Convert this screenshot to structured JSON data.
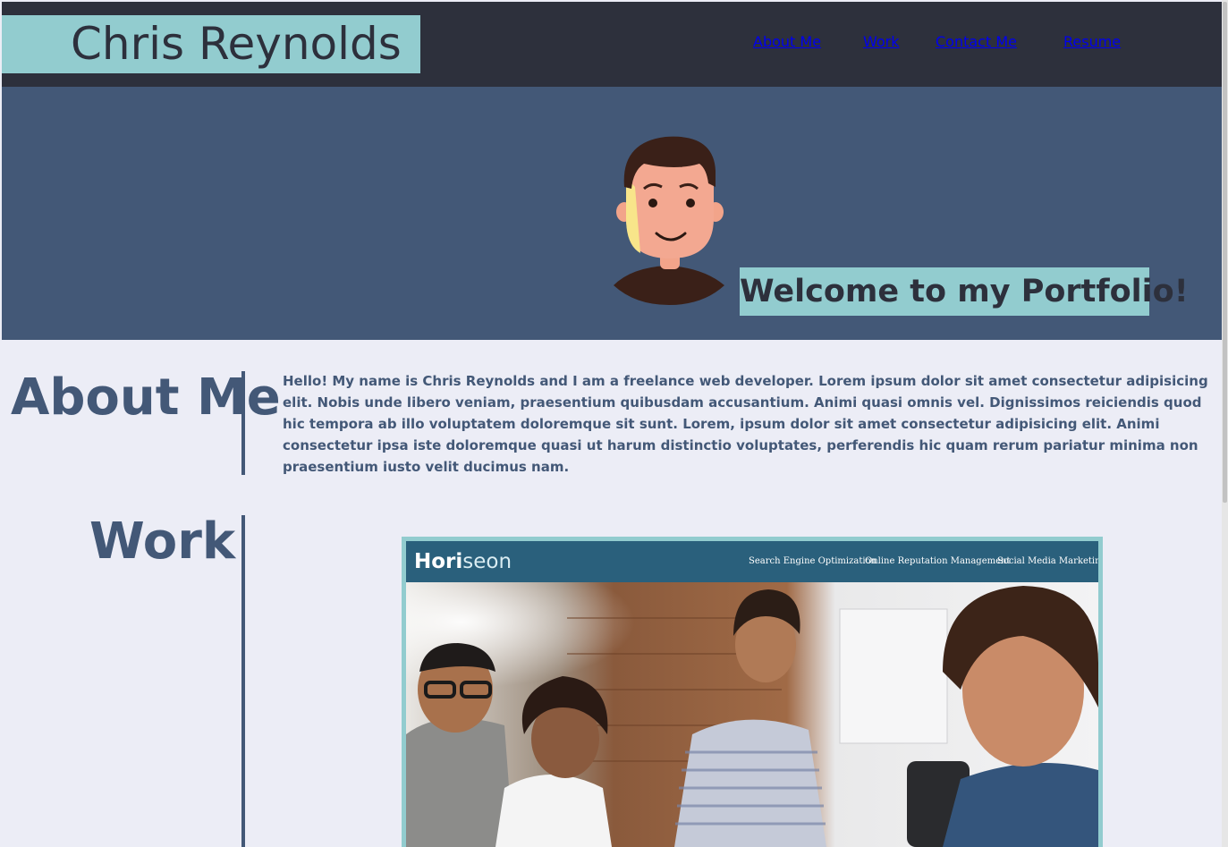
{
  "header": {
    "brand": "Chris Reynolds",
    "nav": [
      {
        "label": "About Me"
      },
      {
        "label": "Work"
      },
      {
        "label": "Contact Me"
      },
      {
        "label": "Resume"
      }
    ]
  },
  "hero": {
    "welcome": "Welcome to my Portfolio!",
    "avatar_icon": "cartoon-man-avatar"
  },
  "about": {
    "title": "About Me",
    "text": "Hello! My name is Chris Reynolds and I am a freelance web developer. Lorem ipsum dolor sit amet consectetur adipisicing elit. Nobis unde libero veniam, praesentium quibusdam accusantium. Animi quasi omnis vel. Dignissimos reiciendis quod hic tempora ab illo voluptatem doloremque sit sunt. Lorem, ipsum dolor sit amet consectetur adipisicing elit. Animi consectetur ipsa iste doloremque quasi ut harum distinctio voluptates, perferendis hic quam rerum pariatur minima non praesentium iusto velit ducimus nam."
  },
  "work": {
    "title": "Work",
    "project": {
      "logo_main": "Hori",
      "logo_accent": "seon",
      "nav": [
        "Search Engine Optimization",
        "Online Reputation Management",
        "Social Media Marketing"
      ]
    }
  },
  "colors": {
    "header_bg": "#2d303c",
    "accent": "#92cccf",
    "hero_bg": "#435877",
    "page_bg": "#ecedf6"
  }
}
